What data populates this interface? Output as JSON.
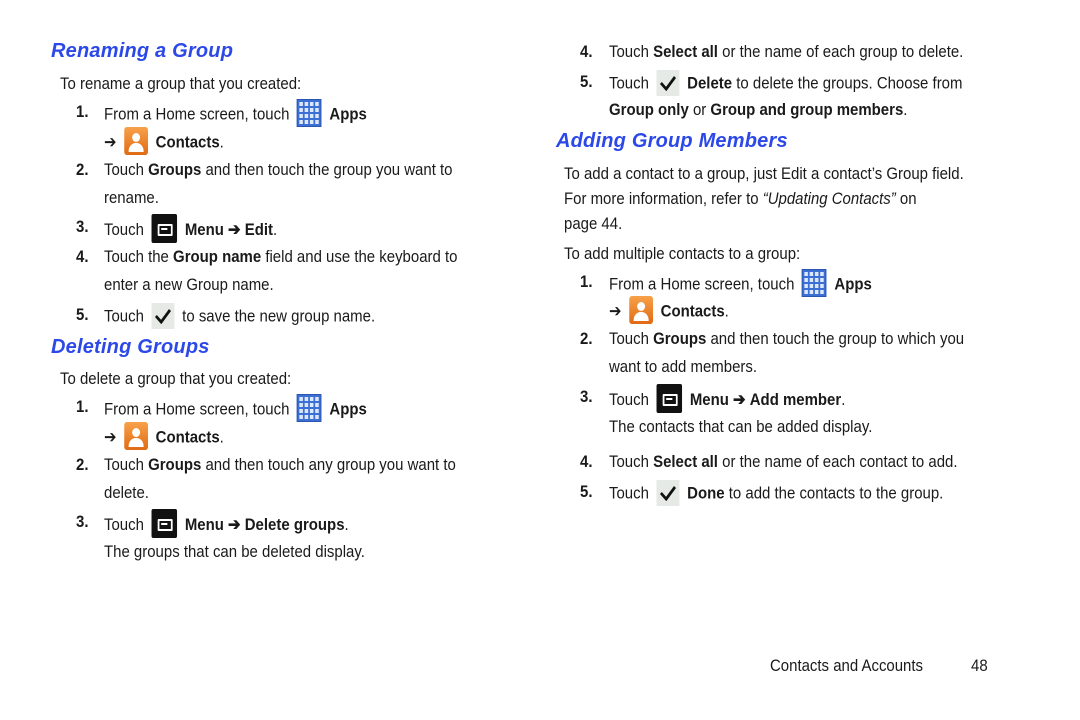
{
  "left": {
    "renaming": {
      "heading": "Renaming a Group",
      "intro": "To rename a group that you created:",
      "steps": [
        {
          "num": "1.",
          "pre": "From a Home screen, touch",
          "apps": "Apps",
          "arrow": "➔",
          "contacts": "Contacts",
          "end": "."
        },
        {
          "num": "2.",
          "pre": "Touch",
          "bold": "Groups",
          "post": "and then touch the group you want to",
          "line2": "rename."
        },
        {
          "num": "3.",
          "pre": "Touch",
          "menu": "Menu",
          "arrow": "➔",
          "target": "Edit",
          "end": "."
        },
        {
          "num": "4.",
          "pre": "Touch the",
          "bold": "Group name",
          "post": "field and use the keyboard to",
          "line2": "enter a new Group name."
        },
        {
          "num": "5.",
          "pre": "Touch",
          "post": "to save the new group name."
        }
      ]
    },
    "deleting": {
      "heading": "Deleting Groups",
      "intro": "To delete a group that you created:",
      "steps": [
        {
          "num": "1.",
          "pre": "From a Home screen, touch",
          "apps": "Apps",
          "arrow": "➔",
          "contacts": "Contacts",
          "end": "."
        },
        {
          "num": "2.",
          "pre": "Touch",
          "bold": "Groups",
          "post": "and then touch any group you want to",
          "line2": "delete."
        },
        {
          "num": "3.",
          "pre": "Touch",
          "menu": "Menu",
          "arrow": "➔",
          "target": "Delete groups",
          "end": ".",
          "note": "The groups that can be deleted display."
        }
      ]
    }
  },
  "right": {
    "deleting_cont": {
      "steps": [
        {
          "num": "4.",
          "pre": "Touch",
          "bold": "Select all",
          "post": "or the name of each group to delete."
        },
        {
          "num": "5.",
          "pre": "Touch",
          "bold": "Delete",
          "post": "to delete the groups. Choose from",
          "line2_b1": "Group only",
          "line2_mid": "or",
          "line2_b2": "Group and group members",
          "end": "."
        }
      ]
    },
    "adding": {
      "heading": "Adding Group Members",
      "para1_line1": "To add a contact to a group, just Edit a contact’s Group field.",
      "para1_line2_pre": "For more information, refer to",
      "para1_line2_ref": "“Updating Contacts”",
      "para1_line2_post": "on",
      "para1_line3": "page 44.",
      "intro": "To add multiple contacts to a group:",
      "steps": [
        {
          "num": "1.",
          "pre": "From a Home screen, touch",
          "apps": "Apps",
          "arrow": "➔",
          "contacts": "Contacts",
          "end": "."
        },
        {
          "num": "2.",
          "pre": "Touch",
          "bold": "Groups",
          "post": "and then touch the group to which you",
          "line2": "want to add members."
        },
        {
          "num": "3.",
          "pre": "Touch",
          "menu": "Menu",
          "arrow": "➔",
          "target": "Add member",
          "end": ".",
          "note": "The contacts that can be added display."
        },
        {
          "num": "4.",
          "pre": "Touch",
          "bold": "Select all",
          "post": "or the name of each contact to add."
        },
        {
          "num": "5.",
          "pre": "Touch",
          "bold": "Done",
          "post": "to add the contacts to the group."
        }
      ]
    }
  },
  "footer": {
    "section": "Contacts and Accounts",
    "page": "48"
  },
  "colors": {
    "heading": "#2c49e8",
    "apps_icon": "#3b6fd4",
    "contacts_icon": "#e8781e",
    "menu_icon": "#111111"
  }
}
